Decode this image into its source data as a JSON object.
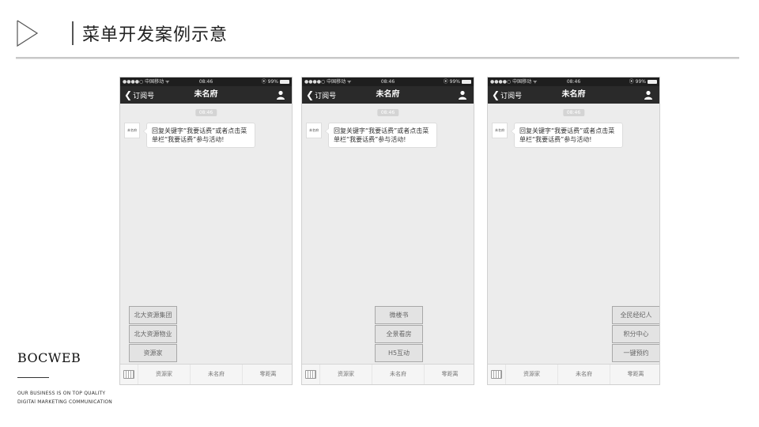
{
  "page": {
    "title": "菜单开发案例示意"
  },
  "brand": {
    "name": "BOCWEB",
    "tagline1": "OUR BUSINESS IS ON TOP QUALITY",
    "tagline2": "DIGITAl MARKETING COMMUNICATION"
  },
  "phones": [
    {
      "status": {
        "carrier": "●●●●○ 中国移动 ᯤ",
        "time": "08:46",
        "battery": "⦿ 99%"
      },
      "nav": {
        "back": "订阅号",
        "title": "未名府"
      },
      "chat": {
        "time": "08:46",
        "avatar_text": "未名府",
        "message": "回复关键字“我要话费”或者点击菜单栏“我要话费”参与活动!"
      },
      "submenu": [
        "北大资源集团",
        "北大资源物业",
        "资源家"
      ],
      "menu": [
        "资源家",
        "未名府",
        "零距离"
      ]
    },
    {
      "status": {
        "carrier": "●●●●○ 中国移动 ᯤ",
        "time": "08:46",
        "battery": "⦿ 99%"
      },
      "nav": {
        "back": "订阅号",
        "title": "未名府"
      },
      "chat": {
        "time": "08:46",
        "avatar_text": "未名府",
        "message": "回复关键字“我要话费”或者点击菜单栏“我要话费”参与活动!"
      },
      "submenu": [
        "微楼书",
        "全景看房",
        "H5互动"
      ],
      "menu": [
        "资源家",
        "未名府",
        "零距离"
      ]
    },
    {
      "status": {
        "carrier": "●●●●○ 中国移动 ᯤ",
        "time": "08:46",
        "battery": "⦿ 99%"
      },
      "nav": {
        "back": "订阅号",
        "title": "未名府"
      },
      "chat": {
        "time": "08:46",
        "avatar_text": "未名府",
        "message": "回复关键字“我要话费”或者点击菜单栏“我要话费”参与活动!"
      },
      "submenu": [
        "全民经纪人",
        "积分中心",
        "一键预约"
      ],
      "menu": [
        "资源家",
        "未名府",
        "零距离"
      ]
    }
  ]
}
